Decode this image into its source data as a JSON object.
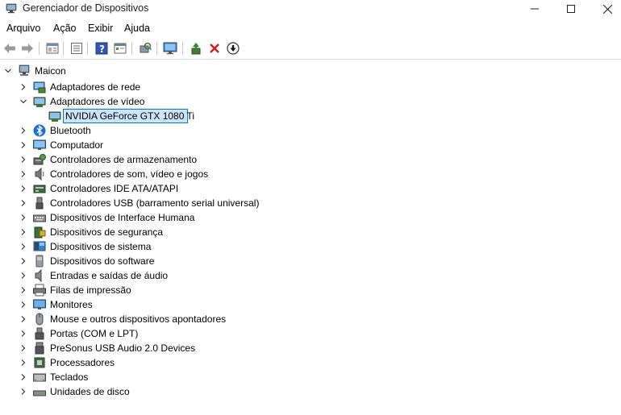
{
  "window": {
    "title": "Gerenciador de Dispositivos"
  },
  "menu": {
    "items": [
      "Arquivo",
      "Ação",
      "Exibir",
      "Ajuda"
    ]
  },
  "toolbar": {
    "buttons": [
      "back-icon",
      "forward-icon",
      "properties-icon",
      "list-icon",
      "help-icon",
      "view-icon",
      "scan-hardware-icon",
      "monitor-icon",
      "update-driver-icon",
      "uninstall-icon",
      "disable-icon"
    ]
  },
  "tree": {
    "root": "Maicon",
    "expanded_category": "Adaptadores de vídeo",
    "selected_device": "NVIDIA GeForce GTX 1080 Ti",
    "categories": [
      {
        "label": "Adaptadores de rede",
        "icon": "network-adapter-icon"
      },
      {
        "label": "Adaptadores de vídeo",
        "icon": "display-adapter-icon"
      },
      {
        "label": "Bluetooth",
        "icon": "bluetooth-icon"
      },
      {
        "label": "Computador",
        "icon": "computer-icon"
      },
      {
        "label": "Controladores de armazenamento",
        "icon": "storage-controller-icon"
      },
      {
        "label": "Controladores de som, vídeo e jogos",
        "icon": "speaker-icon"
      },
      {
        "label": "Controladores IDE ATA/ATAPI",
        "icon": "ide-controller-icon"
      },
      {
        "label": "Controladores USB (barramento serial universal)",
        "icon": "usb-icon"
      },
      {
        "label": "Dispositivos de Interface Humana",
        "icon": "hid-icon"
      },
      {
        "label": "Dispositivos de segurança",
        "icon": "security-device-icon"
      },
      {
        "label": "Dispositivos de sistema",
        "icon": "system-device-icon"
      },
      {
        "label": "Dispositivos do software",
        "icon": "software-device-icon"
      },
      {
        "label": "Entradas e saídas de áudio",
        "icon": "audio-io-icon"
      },
      {
        "label": "Filas de impressão",
        "icon": "printer-icon"
      },
      {
        "label": "Monitores",
        "icon": "monitor-icon"
      },
      {
        "label": "Mouse e outros dispositivos apontadores",
        "icon": "mouse-icon"
      },
      {
        "label": "Portas (COM e LPT)",
        "icon": "port-icon"
      },
      {
        "label": "PreSonus USB Audio 2.0 Devices",
        "icon": "usb-audio-icon"
      },
      {
        "label": "Processadores",
        "icon": "processor-icon"
      },
      {
        "label": "Teclados",
        "icon": "keyboard-icon"
      },
      {
        "label": "Unidades de disco",
        "icon": "disk-drive-icon"
      }
    ]
  }
}
